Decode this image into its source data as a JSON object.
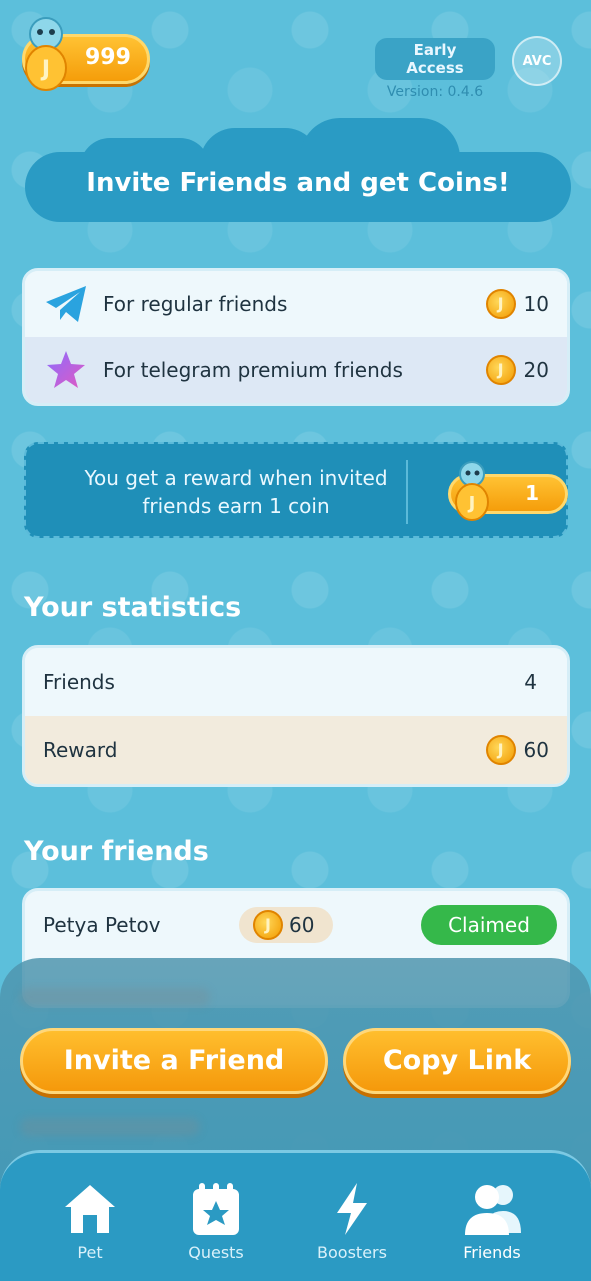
{
  "header": {
    "coin_balance": "999",
    "access_tag": "Early Access",
    "version": "Version: 0.4.6",
    "avc_label": "AVC"
  },
  "hero": {
    "title": "Invite Friends and get Coins!"
  },
  "invite_rewards": [
    {
      "label": "For regular friends",
      "amount": "10",
      "icon": "telegram-plane-icon"
    },
    {
      "label": "For telegram premium friends",
      "amount": "20",
      "icon": "premium-star-icon"
    }
  ],
  "reward_banner": {
    "text": "You get a reward when invited friends earn 1 coin",
    "amount": "1"
  },
  "statistics": {
    "title": "Your statistics",
    "friends_label": "Friends",
    "friends_value": "4",
    "reward_label": "Reward",
    "reward_value": "60"
  },
  "friends": {
    "title": "Your friends",
    "list": [
      {
        "name": "Petya Petov",
        "reward": "60",
        "status": "Claimed"
      }
    ]
  },
  "actions": {
    "invite_label": "Invite a Friend",
    "copy_label": "Copy Link"
  },
  "nav": {
    "items": [
      {
        "label": "Pet",
        "icon": "house-icon"
      },
      {
        "label": "Quests",
        "icon": "quests-icon"
      },
      {
        "label": "Boosters",
        "icon": "lightning-icon"
      },
      {
        "label": "Friends",
        "icon": "friends-icon",
        "active": true
      }
    ]
  },
  "colors": {
    "background": "#5cbfdb",
    "accent_orange": "#f5990b",
    "nav": "#2b9ac3",
    "claimed_green": "#35b84a"
  }
}
